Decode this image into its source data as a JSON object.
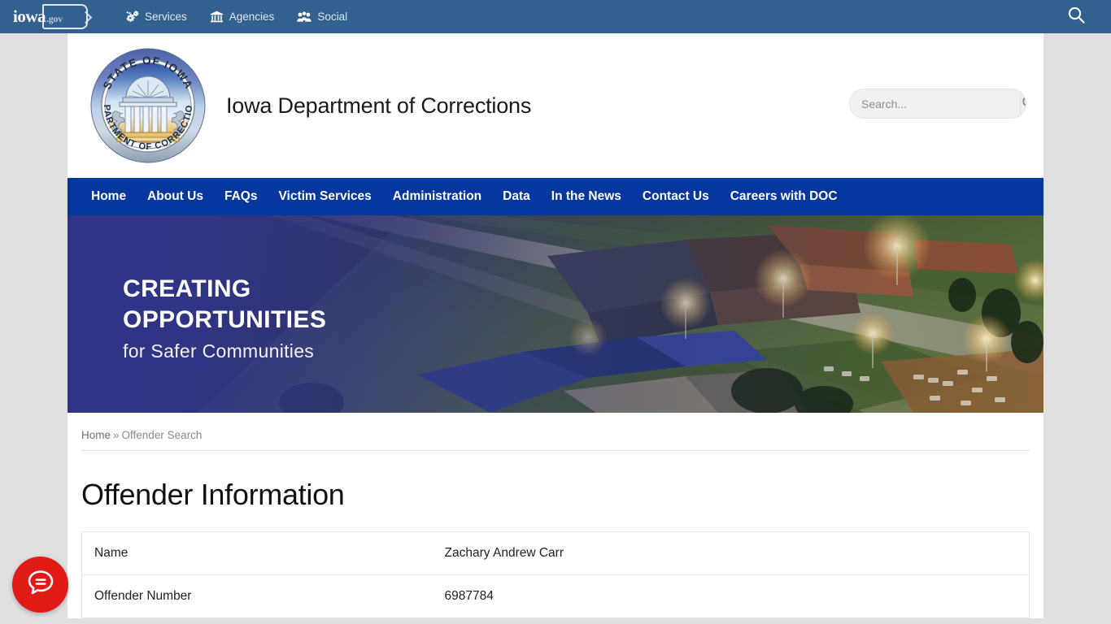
{
  "topbar": {
    "logo": {
      "word": "iowa",
      "suffix": ".gov",
      "icon": "iowa-state-outline-icon"
    },
    "items": [
      {
        "label": "Services",
        "icon": "cogs-icon"
      },
      {
        "label": "Agencies",
        "icon": "bank-icon"
      },
      {
        "label": "Social",
        "icon": "people-group-icon"
      }
    ],
    "search_icon": "search-icon",
    "background_color": "#33618f"
  },
  "header": {
    "seal": {
      "top_text": "STATE OF IOWA",
      "bottom_text": "DEPARTMENT OF CORRECTIONS",
      "icon": "state-seal-icon"
    },
    "site_title": "Iowa Department of Corrections",
    "search": {
      "placeholder": "Search...",
      "value": "",
      "button_icon": "search-icon"
    }
  },
  "mainnav": {
    "background_color": "#06379e",
    "items": [
      {
        "label": "Home"
      },
      {
        "label": "About Us"
      },
      {
        "label": "FAQs"
      },
      {
        "label": "Victim Services"
      },
      {
        "label": "Administration"
      },
      {
        "label": "Data"
      },
      {
        "label": "In the News"
      },
      {
        "label": "Contact Us"
      },
      {
        "label": "Careers with DOC"
      }
    ]
  },
  "hero": {
    "line1": "CREATING",
    "line2": "OPPORTUNITIES",
    "line3": "for Safer Communities",
    "overlay_color": "#30348c"
  },
  "breadcrumb": {
    "home": "Home",
    "separator": "»",
    "current": "Offender Search"
  },
  "main": {
    "page_title": "Offender Information",
    "rows": [
      {
        "label": "Name",
        "value": "Zachary Andrew Carr"
      },
      {
        "label": "Offender Number",
        "value": "6987784"
      }
    ]
  },
  "chat": {
    "icon": "chat-bubble-icon",
    "color": "#e01b17"
  }
}
